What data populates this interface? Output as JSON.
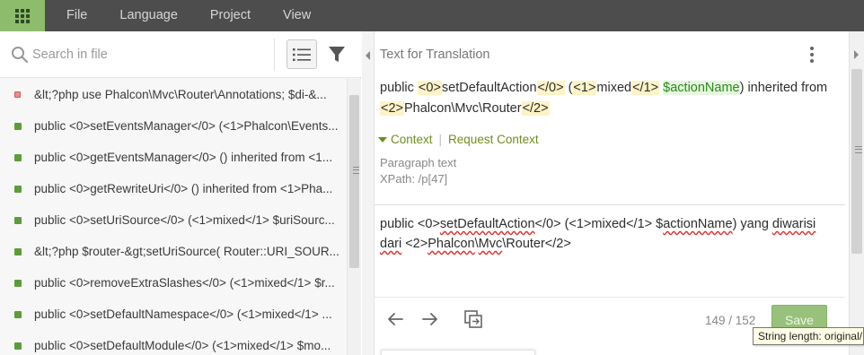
{
  "menu": {
    "apps_icon": "grid-icon",
    "items": [
      "File",
      "Language",
      "Project",
      "View"
    ]
  },
  "search": {
    "placeholder": "Search in file"
  },
  "strings": [
    {
      "text": "&lt;?php use Phalcon\\Mvc\\Router\\Annotations; $di-&...",
      "status": "untranslated"
    },
    {
      "text": "public <0>setEventsManager</0> (<1>Phalcon\\Events...",
      "status": "translated"
    },
    {
      "text": "public <0>getEventsManager</0> () inherited from <1...",
      "status": "translated"
    },
    {
      "text": "public <0>getRewriteUri</0> () inherited from <1>Pha...",
      "status": "translated"
    },
    {
      "text": "public <0>setUriSource</0> (<1>mixed</1> $uriSourc...",
      "status": "translated"
    },
    {
      "text": "&lt;?php $router-&gt;setUriSource( Router::URI_SOUR...",
      "status": "translated"
    },
    {
      "text": "public <0>removeExtraSlashes</0> (<1>mixed</1> $r...",
      "status": "translated"
    },
    {
      "text": "public <0>setDefaultNamespace</0> (<1>mixed</1> ...",
      "status": "translated"
    },
    {
      "text": "public <0>setDefaultModule</0> (<1>mixed</1> $mo...",
      "status": "translated"
    }
  ],
  "editor": {
    "title": "Text for Translation",
    "source": {
      "p1": "public ",
      "t0o": "<0>",
      "p2": "setDefaultAction",
      "t0c": "</0>",
      "p3": " (",
      "t1o": "<1>",
      "p4": "mixed",
      "t1c": "</1>",
      "p5": " ",
      "var": "$actionName",
      "p6": ") inherited from ",
      "t2o": "<2>",
      "p7": "Phalcon\\Mvc\\Router",
      "t2c": "</2>"
    },
    "context_label": "Context",
    "request_context": "Request Context",
    "paragraph_text": "Paragraph text",
    "xpath": "XPath: /p[47]",
    "translation": {
      "a": "public <0>",
      "b": "setDefaultAction",
      "c": "</0> (<1>mixed</1> $",
      "d": "actionName",
      "e": ") yang ",
      "f": "diwarisi",
      "g": " ",
      "h": "dari",
      "i": " <2>",
      "j": "Phalcon",
      "k": "\\",
      "l": "Mvc",
      "m": "\\Router</2>"
    },
    "counter": "149 / 152",
    "save_label": "Save"
  },
  "tooltip": "String length: original/",
  "colors": {
    "topbar": "#4d4d4d",
    "accent_green": "#8cbc6c",
    "context_green": "#6c8e1c",
    "tag_highlight": "#fdf3c6",
    "var_green": "#2c8a1e",
    "save_bg": "#98c17c"
  }
}
